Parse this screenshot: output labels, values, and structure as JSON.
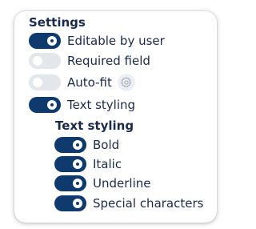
{
  "settings": {
    "title": "Settings",
    "items": [
      {
        "label": "Editable by user",
        "on": true
      },
      {
        "label": "Required field",
        "on": false
      },
      {
        "label": "Auto-fit",
        "on": false
      },
      {
        "label": "Text styling",
        "on": true
      }
    ]
  },
  "text_styling": {
    "title": "Text styling",
    "items": [
      {
        "label": "Bold",
        "on": true
      },
      {
        "label": "Italic",
        "on": true
      },
      {
        "label": "Underline",
        "on": true
      },
      {
        "label": "Special characters",
        "on": true
      }
    ]
  },
  "colors": {
    "toggle_on": "#0f3a6e",
    "toggle_off": "#e3e6ea",
    "text": "#1b2a4a"
  },
  "icons": {
    "auto_fit_settings": "gear-icon"
  }
}
